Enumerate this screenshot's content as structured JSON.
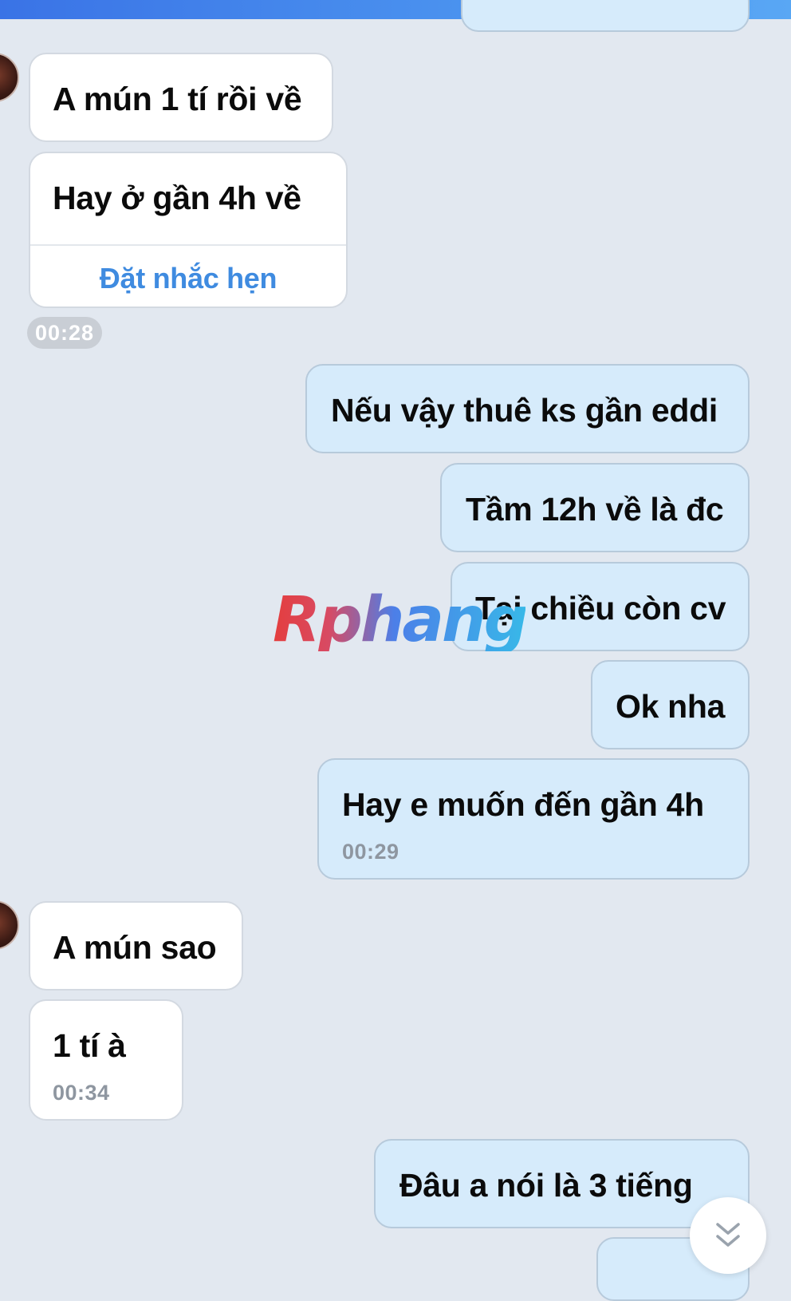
{
  "messages": [
    {
      "id": "m1",
      "side": "in",
      "text": "A mún 1 tí rồi về"
    },
    {
      "id": "m2",
      "side": "in",
      "text": "Hay ở gần 4h về",
      "action": "Đặt nhắc hẹn"
    },
    {
      "id": "m3",
      "side": "out",
      "text": "Nếu vậy thuê ks gần eddi"
    },
    {
      "id": "m4",
      "side": "out",
      "text": "Tầm 12h về là đc"
    },
    {
      "id": "m5",
      "side": "out",
      "text": "Tại chiều còn cv"
    },
    {
      "id": "m6",
      "side": "out",
      "text": "Ok nha"
    },
    {
      "id": "m7",
      "side": "out",
      "text": "Hay e muốn đến gần 4h",
      "time": "00:29"
    },
    {
      "id": "m8",
      "side": "in",
      "text": "A mún sao"
    },
    {
      "id": "m9",
      "side": "in",
      "text": "1 tí à",
      "time": "00:34"
    },
    {
      "id": "m10",
      "side": "out",
      "text": "Đâu a nói là 3 tiếng"
    }
  ],
  "time_pill": "00:28",
  "watermark": "Rphang",
  "scroll_icon": "double-chevron-down-icon",
  "colors": {
    "incoming_bubble": "#ffffff",
    "outgoing_bubble": "#d6ebfb",
    "background": "#e2e8f0",
    "accent": "#3f8be0"
  }
}
